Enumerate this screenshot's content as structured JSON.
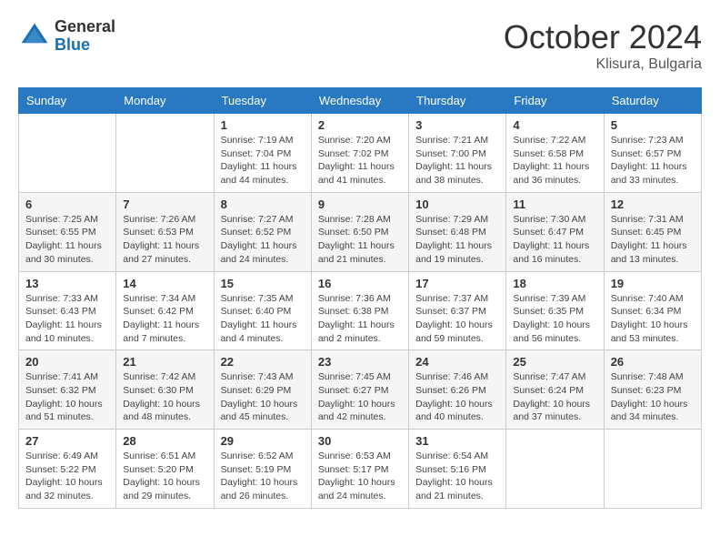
{
  "header": {
    "logo": {
      "general": "General",
      "blue": "Blue"
    },
    "title": "October 2024",
    "location": "Klisura, Bulgaria"
  },
  "calendar": {
    "days_of_week": [
      "Sunday",
      "Monday",
      "Tuesday",
      "Wednesday",
      "Thursday",
      "Friday",
      "Saturday"
    ],
    "weeks": [
      [
        {
          "day": "",
          "sunrise": "",
          "sunset": "",
          "daylight": ""
        },
        {
          "day": "",
          "sunrise": "",
          "sunset": "",
          "daylight": ""
        },
        {
          "day": "1",
          "sunrise": "Sunrise: 7:19 AM",
          "sunset": "Sunset: 7:04 PM",
          "daylight": "Daylight: 11 hours and 44 minutes."
        },
        {
          "day": "2",
          "sunrise": "Sunrise: 7:20 AM",
          "sunset": "Sunset: 7:02 PM",
          "daylight": "Daylight: 11 hours and 41 minutes."
        },
        {
          "day": "3",
          "sunrise": "Sunrise: 7:21 AM",
          "sunset": "Sunset: 7:00 PM",
          "daylight": "Daylight: 11 hours and 38 minutes."
        },
        {
          "day": "4",
          "sunrise": "Sunrise: 7:22 AM",
          "sunset": "Sunset: 6:58 PM",
          "daylight": "Daylight: 11 hours and 36 minutes."
        },
        {
          "day": "5",
          "sunrise": "Sunrise: 7:23 AM",
          "sunset": "Sunset: 6:57 PM",
          "daylight": "Daylight: 11 hours and 33 minutes."
        }
      ],
      [
        {
          "day": "6",
          "sunrise": "Sunrise: 7:25 AM",
          "sunset": "Sunset: 6:55 PM",
          "daylight": "Daylight: 11 hours and 30 minutes."
        },
        {
          "day": "7",
          "sunrise": "Sunrise: 7:26 AM",
          "sunset": "Sunset: 6:53 PM",
          "daylight": "Daylight: 11 hours and 27 minutes."
        },
        {
          "day": "8",
          "sunrise": "Sunrise: 7:27 AM",
          "sunset": "Sunset: 6:52 PM",
          "daylight": "Daylight: 11 hours and 24 minutes."
        },
        {
          "day": "9",
          "sunrise": "Sunrise: 7:28 AM",
          "sunset": "Sunset: 6:50 PM",
          "daylight": "Daylight: 11 hours and 21 minutes."
        },
        {
          "day": "10",
          "sunrise": "Sunrise: 7:29 AM",
          "sunset": "Sunset: 6:48 PM",
          "daylight": "Daylight: 11 hours and 19 minutes."
        },
        {
          "day": "11",
          "sunrise": "Sunrise: 7:30 AM",
          "sunset": "Sunset: 6:47 PM",
          "daylight": "Daylight: 11 hours and 16 minutes."
        },
        {
          "day": "12",
          "sunrise": "Sunrise: 7:31 AM",
          "sunset": "Sunset: 6:45 PM",
          "daylight": "Daylight: 11 hours and 13 minutes."
        }
      ],
      [
        {
          "day": "13",
          "sunrise": "Sunrise: 7:33 AM",
          "sunset": "Sunset: 6:43 PM",
          "daylight": "Daylight: 11 hours and 10 minutes."
        },
        {
          "day": "14",
          "sunrise": "Sunrise: 7:34 AM",
          "sunset": "Sunset: 6:42 PM",
          "daylight": "Daylight: 11 hours and 7 minutes."
        },
        {
          "day": "15",
          "sunrise": "Sunrise: 7:35 AM",
          "sunset": "Sunset: 6:40 PM",
          "daylight": "Daylight: 11 hours and 4 minutes."
        },
        {
          "day": "16",
          "sunrise": "Sunrise: 7:36 AM",
          "sunset": "Sunset: 6:38 PM",
          "daylight": "Daylight: 11 hours and 2 minutes."
        },
        {
          "day": "17",
          "sunrise": "Sunrise: 7:37 AM",
          "sunset": "Sunset: 6:37 PM",
          "daylight": "Daylight: 10 hours and 59 minutes."
        },
        {
          "day": "18",
          "sunrise": "Sunrise: 7:39 AM",
          "sunset": "Sunset: 6:35 PM",
          "daylight": "Daylight: 10 hours and 56 minutes."
        },
        {
          "day": "19",
          "sunrise": "Sunrise: 7:40 AM",
          "sunset": "Sunset: 6:34 PM",
          "daylight": "Daylight: 10 hours and 53 minutes."
        }
      ],
      [
        {
          "day": "20",
          "sunrise": "Sunrise: 7:41 AM",
          "sunset": "Sunset: 6:32 PM",
          "daylight": "Daylight: 10 hours and 51 minutes."
        },
        {
          "day": "21",
          "sunrise": "Sunrise: 7:42 AM",
          "sunset": "Sunset: 6:30 PM",
          "daylight": "Daylight: 10 hours and 48 minutes."
        },
        {
          "day": "22",
          "sunrise": "Sunrise: 7:43 AM",
          "sunset": "Sunset: 6:29 PM",
          "daylight": "Daylight: 10 hours and 45 minutes."
        },
        {
          "day": "23",
          "sunrise": "Sunrise: 7:45 AM",
          "sunset": "Sunset: 6:27 PM",
          "daylight": "Daylight: 10 hours and 42 minutes."
        },
        {
          "day": "24",
          "sunrise": "Sunrise: 7:46 AM",
          "sunset": "Sunset: 6:26 PM",
          "daylight": "Daylight: 10 hours and 40 minutes."
        },
        {
          "day": "25",
          "sunrise": "Sunrise: 7:47 AM",
          "sunset": "Sunset: 6:24 PM",
          "daylight": "Daylight: 10 hours and 37 minutes."
        },
        {
          "day": "26",
          "sunrise": "Sunrise: 7:48 AM",
          "sunset": "Sunset: 6:23 PM",
          "daylight": "Daylight: 10 hours and 34 minutes."
        }
      ],
      [
        {
          "day": "27",
          "sunrise": "Sunrise: 6:49 AM",
          "sunset": "Sunset: 5:22 PM",
          "daylight": "Daylight: 10 hours and 32 minutes."
        },
        {
          "day": "28",
          "sunrise": "Sunrise: 6:51 AM",
          "sunset": "Sunset: 5:20 PM",
          "daylight": "Daylight: 10 hours and 29 minutes."
        },
        {
          "day": "29",
          "sunrise": "Sunrise: 6:52 AM",
          "sunset": "Sunset: 5:19 PM",
          "daylight": "Daylight: 10 hours and 26 minutes."
        },
        {
          "day": "30",
          "sunrise": "Sunrise: 6:53 AM",
          "sunset": "Sunset: 5:17 PM",
          "daylight": "Daylight: 10 hours and 24 minutes."
        },
        {
          "day": "31",
          "sunrise": "Sunrise: 6:54 AM",
          "sunset": "Sunset: 5:16 PM",
          "daylight": "Daylight: 10 hours and 21 minutes."
        },
        {
          "day": "",
          "sunrise": "",
          "sunset": "",
          "daylight": ""
        },
        {
          "day": "",
          "sunrise": "",
          "sunset": "",
          "daylight": ""
        }
      ]
    ]
  }
}
